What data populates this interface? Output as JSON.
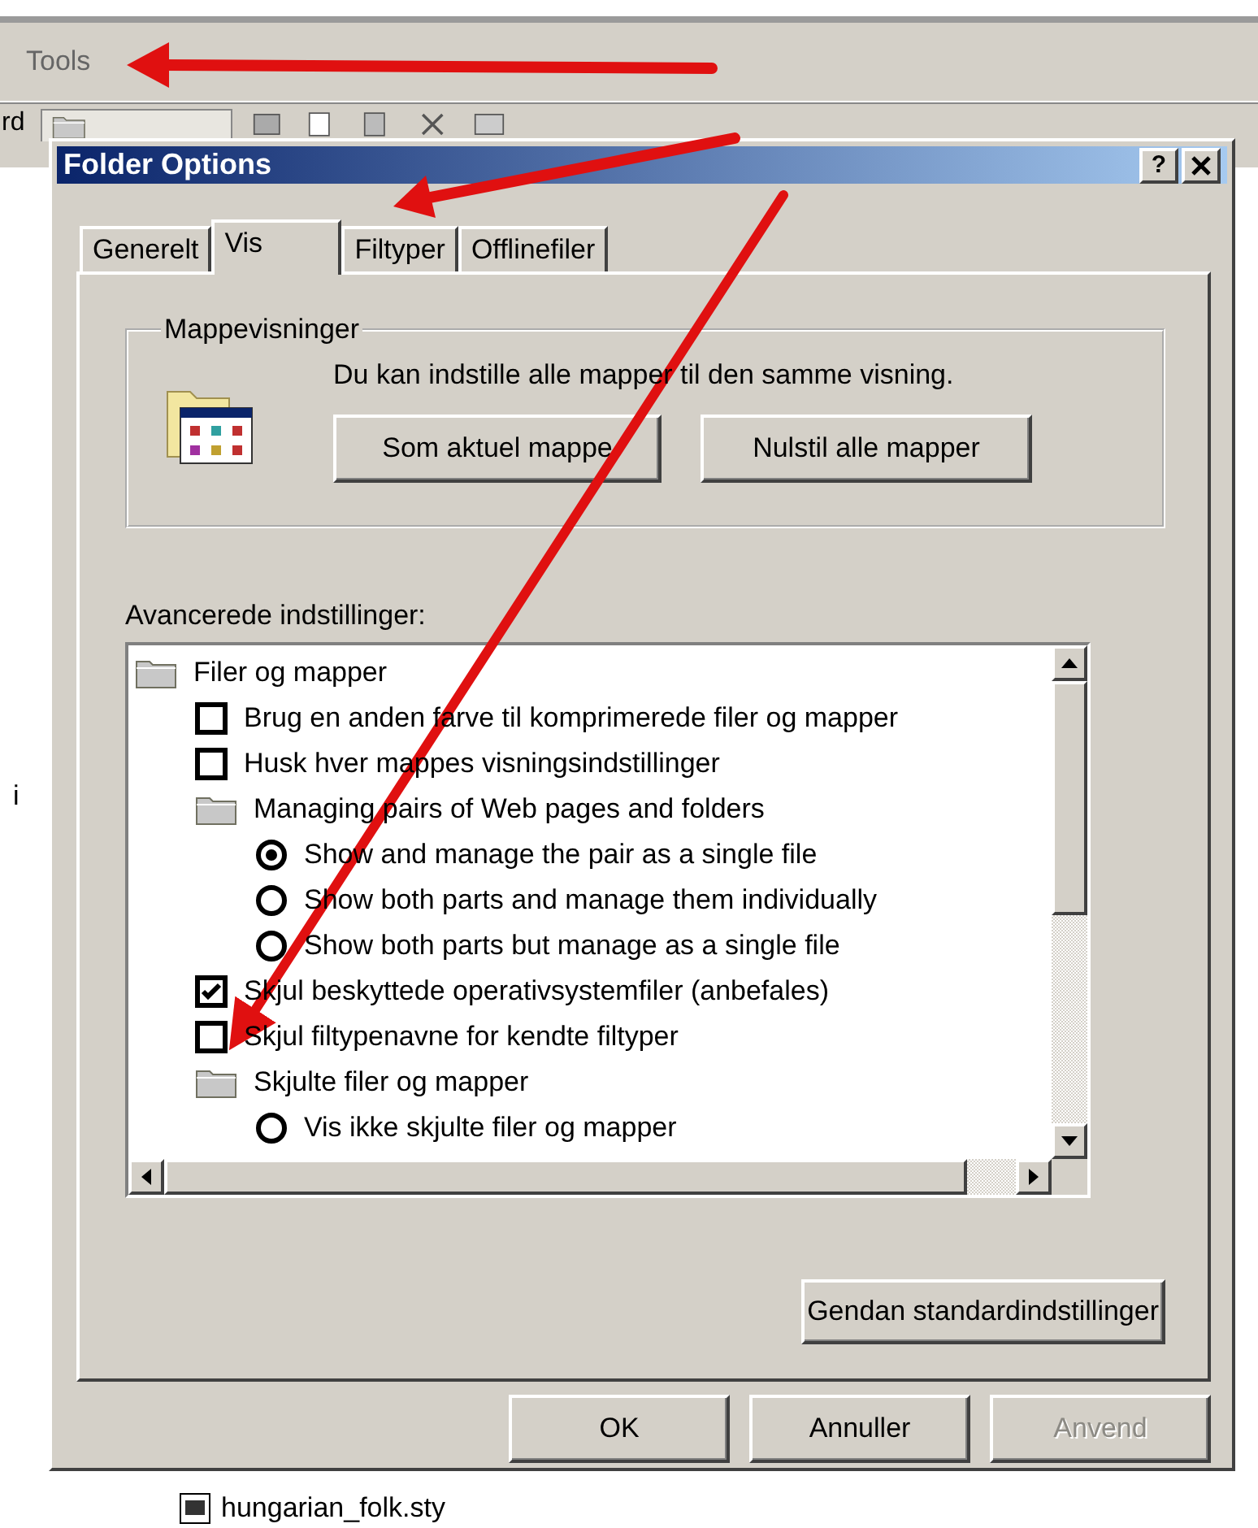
{
  "background_window": {
    "menu": [
      "Tools"
    ],
    "toolbar_text": "rd",
    "side_text": "i",
    "file_item": "hungarian_folk.sty"
  },
  "dialog": {
    "title": "Folder Options",
    "title_buttons": [
      "?"
    ],
    "tabs": [
      {
        "label": "Generelt",
        "selected": false
      },
      {
        "label": "Vis",
        "selected": true
      },
      {
        "label": "Filtyper",
        "selected": false
      },
      {
        "label": "Offlinefiler",
        "selected": false
      }
    ],
    "folder_views": {
      "title": "Mappevisninger",
      "text": "Du kan indstille alle mapper til den samme visning.",
      "buttons": [
        "Som aktuel mappe",
        "Nulstil alle mapper"
      ]
    },
    "advanced_label": "Avancerede indstillinger:",
    "tree": [
      {
        "kind": "folder",
        "label": "Filer og mapper",
        "children": [
          {
            "kind": "checkbox",
            "label": "Brug en anden farve til komprimerede filer og mapper",
            "checked": false
          },
          {
            "kind": "checkbox",
            "label": "Husk hver mappes visningsindstillinger",
            "checked": false
          },
          {
            "kind": "folder",
            "label": "Managing pairs of Web pages and folders",
            "children": [
              {
                "kind": "radio",
                "label": "Show and manage the pair as a single file",
                "selected": true
              },
              {
                "kind": "radio",
                "label": "Show both parts and manage them individually",
                "selected": false
              },
              {
                "kind": "radio",
                "label": "Show both parts but manage as a single file",
                "selected": false
              }
            ]
          },
          {
            "kind": "checkbox",
            "label": "Skjul beskyttede operativsystemfiler (anbefales)",
            "checked": true
          },
          {
            "kind": "checkbox",
            "label": "Skjul filtypenavne for kendte filtyper",
            "checked": false
          },
          {
            "kind": "folder",
            "label": "Skjulte filer og mapper",
            "children": [
              {
                "kind": "radio",
                "label": "Vis ikke skjulte filer og mapper",
                "selected": false
              }
            ]
          }
        ]
      }
    ],
    "restore_button": "Gendan standardindstillinger",
    "buttons": [
      {
        "label": "OK",
        "disabled": false
      },
      {
        "label": "Annuller",
        "disabled": false
      },
      {
        "label": "Anvend",
        "disabled": true
      }
    ]
  }
}
